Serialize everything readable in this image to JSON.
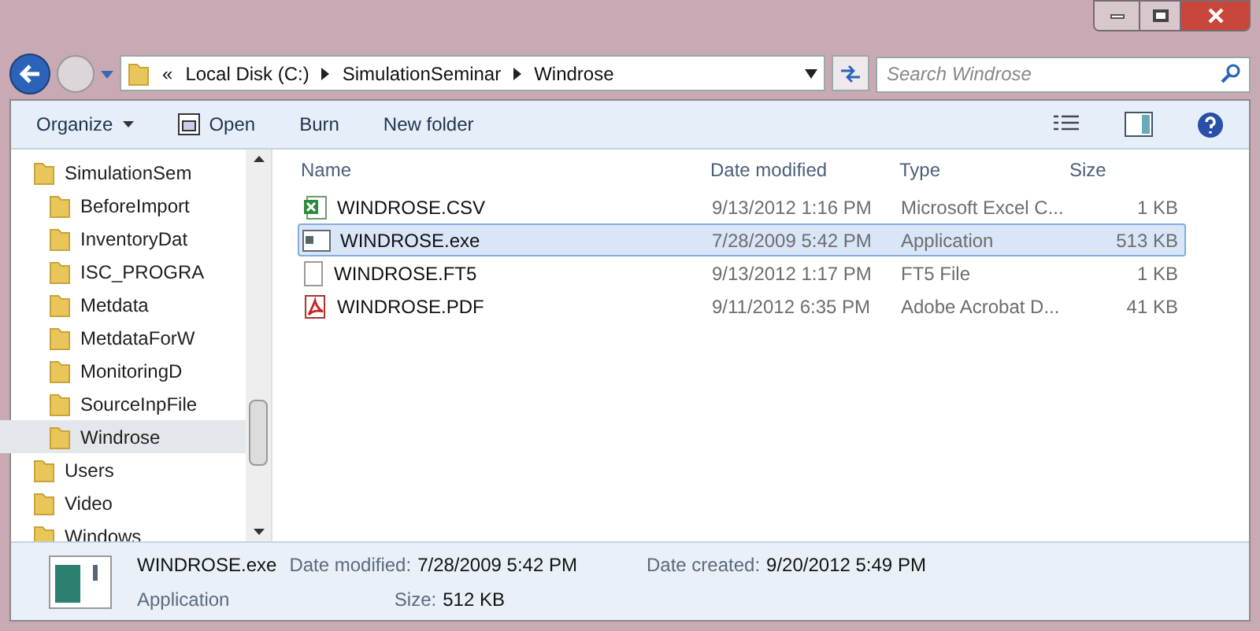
{
  "nav": {
    "back_enabled": true,
    "forward_enabled": false
  },
  "address": {
    "overflow": "«",
    "crumbs": [
      "Local Disk (C:)",
      "SimulationSeminar",
      "Windrose"
    ]
  },
  "search": {
    "placeholder": "Search Windrose"
  },
  "toolbar": {
    "buttons": [
      {
        "label": "Organize",
        "kind": "menu"
      },
      {
        "label": "Open",
        "kind": "icon"
      },
      {
        "label": "Burn",
        "kind": "plain"
      },
      {
        "label": "New folder",
        "kind": "plain"
      }
    ]
  },
  "tree": [
    {
      "label": "SimulationSem",
      "selected": false,
      "children": [
        {
          "label": "BeforeImport",
          "selected": false
        },
        {
          "label": "InventoryDat",
          "selected": false
        },
        {
          "label": "ISC_PROGRA",
          "selected": false
        },
        {
          "label": "Metdata",
          "selected": false
        },
        {
          "label": "MetdataForW",
          "selected": false
        },
        {
          "label": "MonitoringD",
          "selected": false
        },
        {
          "label": "SourceInpFile",
          "selected": false
        },
        {
          "label": "Windrose",
          "selected": true
        }
      ]
    },
    {
      "label": "Users",
      "selected": false
    },
    {
      "label": "Video",
      "selected": false
    },
    {
      "label": "Windows",
      "selected": false
    }
  ],
  "table": {
    "columns": [
      "Name",
      "Date modified",
      "Type",
      "Size"
    ],
    "rows": [
      {
        "kind": "excel",
        "name": "WINDROSE.CSV",
        "date": "9/13/2012 1:16 PM",
        "type": "Microsoft Excel C...",
        "size": "1 KB",
        "selected": false
      },
      {
        "kind": "exe",
        "name": "WINDROSE.exe",
        "date": "7/28/2009 5:42 PM",
        "type": "Application",
        "size": "513 KB",
        "selected": true
      },
      {
        "kind": "blank",
        "name": "WINDROSE.FT5",
        "date": "9/13/2012 1:17 PM",
        "type": "FT5 File",
        "size": "1 KB",
        "selected": false
      },
      {
        "kind": "pdf",
        "name": "WINDROSE.PDF",
        "date": "9/11/2012 6:35 PM",
        "type": "Adobe Acrobat D...",
        "size": "41 KB",
        "selected": false
      }
    ]
  },
  "details": {
    "name": "WINDROSE.exe",
    "type": "Application",
    "fields": [
      {
        "label": "Date modified:",
        "value": "7/28/2009 5:42 PM"
      },
      {
        "label": "Size:",
        "value": "512 KB"
      },
      {
        "label": "Date created:",
        "value": "9/20/2012 5:49 PM"
      }
    ]
  }
}
